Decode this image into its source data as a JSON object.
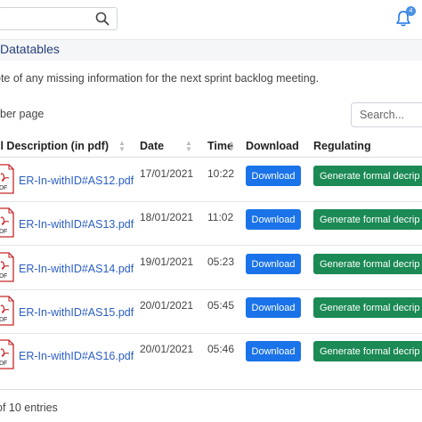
{
  "header": {
    "search_icon": "search-icon",
    "notification_icon": "bell-icon",
    "notification_count": "4",
    "accent_color": "#4a90e2"
  },
  "page": {
    "title": "Datatables",
    "note": "ote of any missing information for the next sprint backlog meeting.",
    "per_page_label": "ber page",
    "search_placeholder": "Search...",
    "entries_info": "of 10 entries"
  },
  "table": {
    "headers": {
      "description": "ll Description (in pdf)",
      "date": "Date",
      "time": "Time",
      "download": "Download",
      "regulating": "Regulating"
    },
    "download_label": "Download",
    "generate_label": "Generate formal decrip",
    "download_color": "#1a73e8",
    "generate_color": "#1b8a55",
    "rows": [
      {
        "file": "ER-In-withID#AS12.pdf",
        "date": "17/01/2021",
        "time": "10:22"
      },
      {
        "file": "ER-In-withID#AS13.pdf",
        "date": "18/01/2021",
        "time": "11:02"
      },
      {
        "file": "ER-In-withID#AS14.pdf",
        "date": "19/01/2021",
        "time": "05:23"
      },
      {
        "file": "ER-In-withID#AS15.pdf",
        "date": "20/01/2021",
        "time": "05:45"
      },
      {
        "file": "ER-In-withID#AS16.pdf",
        "date": "20/01/2021",
        "time": "05:46"
      }
    ]
  }
}
